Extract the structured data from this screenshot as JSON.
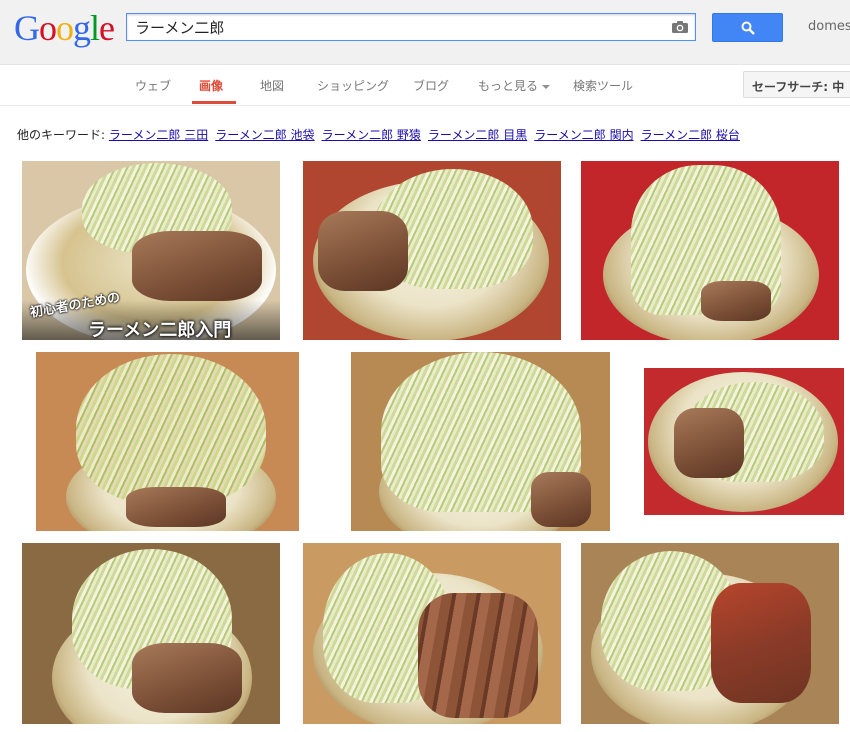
{
  "header": {
    "logo_letters": [
      {
        "char": "G",
        "color": "#3369e8"
      },
      {
        "char": "o",
        "color": "#d50f25"
      },
      {
        "char": "o",
        "color": "#eeb211"
      },
      {
        "char": "g",
        "color": "#3369e8"
      },
      {
        "char": "l",
        "color": "#009925"
      },
      {
        "char": "e",
        "color": "#d50f25"
      }
    ],
    "search_value": "ラーメン二郎",
    "camera_icon": "camera-icon",
    "search_icon": "search-icon",
    "user_name": "domes"
  },
  "nav": {
    "items": [
      {
        "label": "ウェブ",
        "active": false
      },
      {
        "label": "画像",
        "active": true
      },
      {
        "label": "地図",
        "active": false
      },
      {
        "label": "ショッピング",
        "active": false
      },
      {
        "label": "ブログ",
        "active": false
      },
      {
        "label": "もっと見る",
        "active": false
      },
      {
        "label": "検索ツール",
        "active": false
      }
    ],
    "safesearch_label": "セーフサーチ: 中"
  },
  "related": {
    "label": "他のキーワード:",
    "keywords": [
      "ラーメン二郎 三田",
      "ラーメン二郎 池袋",
      "ラーメン二郎 野猿",
      "ラーメン二郎 目黒",
      "ラーメン二郎 関内",
      "ラーメン二郎 桜台"
    ]
  },
  "thumbnails": [
    {
      "caption_small": "初心者のための",
      "caption_big": "ラーメン二郎入門",
      "bg": "#d9c7a8"
    },
    {
      "bg": "#b0462f"
    },
    {
      "bg": "#c2262a"
    },
    {
      "bg": "#c88a55"
    },
    {
      "bg": "#b68a52"
    },
    {
      "bg": "#c32a2e"
    },
    {
      "bg": "#8a6a42"
    },
    {
      "bg": "#c99a62"
    },
    {
      "bg": "#a88457"
    }
  ],
  "colors": {
    "link": "#1a0dab",
    "active_tab": "#dd4b39",
    "search_button": "#4285f4"
  }
}
